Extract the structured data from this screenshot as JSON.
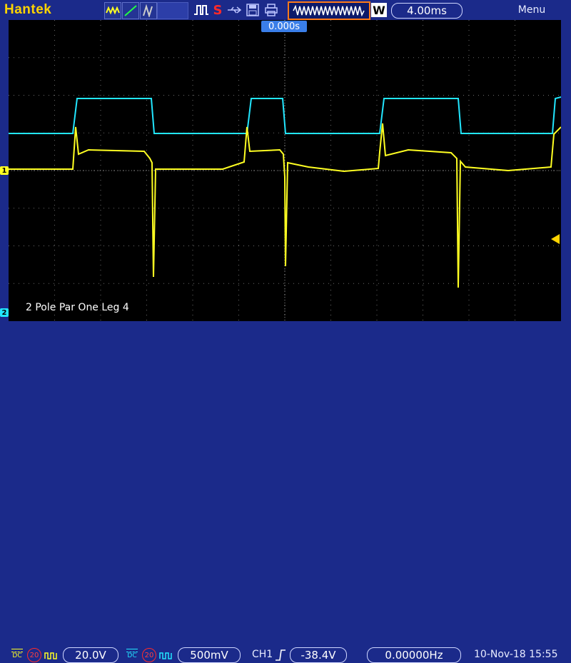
{
  "brand": "Hantek",
  "toolbar": {
    "icons": [
      "waveform-mode-icon",
      "line-mode-icon",
      "persist-mode-icon",
      "run-pulse-icon",
      "stop-s-icon",
      "usb-icon",
      "save-icon",
      "print-icon"
    ],
    "stop_label": "S",
    "timebase_wave_icon": "timebase-window-icon",
    "w_label": "W",
    "timebase": "4.00ms",
    "menu_label": "Menu"
  },
  "screen": {
    "trigger_position": "0.000s",
    "ch1_marker": "1",
    "ch2_marker": "2",
    "waveform_label": "2 Pole Par One Leg 4",
    "colors": {
      "ch1": "#ffff22",
      "ch2": "#22e6ff",
      "grid": "#6b6b6b",
      "trigger_marker": "#ffd400"
    }
  },
  "bottombar": {
    "ch1": {
      "coupling_top": "",
      "coupling_bottom": "DC",
      "bw_limit": "20",
      "probe_icon": "probe-icon",
      "scale": "20.0V"
    },
    "ch2": {
      "coupling_top": "",
      "coupling_bottom": "DC",
      "bw_limit": "20",
      "probe_icon": "probe-icon",
      "scale": "500mV"
    },
    "trigger": {
      "source": "CH1",
      "edge_icon": "rising-edge-icon",
      "level": "-38.4V"
    },
    "frequency": "0.00000Hz",
    "datetime": "10-Nov-18 15:55"
  }
}
